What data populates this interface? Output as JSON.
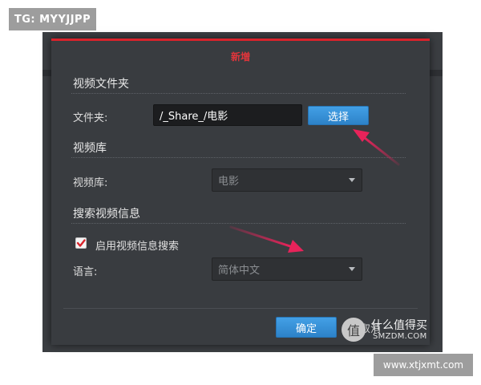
{
  "overlay": {
    "tg_badge": "TG: MYYJJPP",
    "watermark_title": "什么值得买",
    "watermark_logo": "值",
    "watermark_url": "SMZDM.COM",
    "site_badge": "www.xtjxmt.com"
  },
  "dialog": {
    "title": "新増",
    "section_video_folder": "视频文件夹",
    "folder_label": "文件夹:",
    "folder_value": "/_Share_/电影",
    "choose_button": "选择",
    "section_library": "视频库",
    "library_label": "视频库:",
    "library_value": "电影",
    "section_search": "搜索视频信息",
    "enable_search_label": "启用视频信息搜索",
    "enable_search_checked": true,
    "language_label": "语言:",
    "language_value": "简体中文",
    "ok_button": "确定",
    "cancel_button": "取消"
  },
  "colors": {
    "accent_red": "#d9232b",
    "button_blue": "#3a92d8",
    "annotation_arrow": "#e8235a"
  },
  "icons": [
    "checkmark-icon",
    "dropdown-caret-icon",
    "annotation-arrow-icon",
    "smzdm-logo-icon"
  ]
}
